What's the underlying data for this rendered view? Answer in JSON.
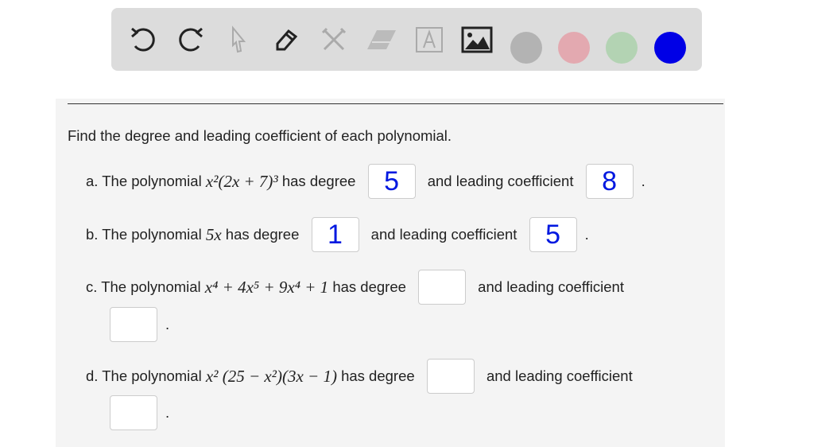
{
  "toolbar": {
    "tools": [
      {
        "name": "undo-icon",
        "active": true
      },
      {
        "name": "redo-icon",
        "active": true
      },
      {
        "name": "pointer-icon",
        "active": false
      },
      {
        "name": "pencil-icon",
        "active": true
      },
      {
        "name": "tools-icon",
        "active": false
      },
      {
        "name": "eraser-icon",
        "active": false
      },
      {
        "name": "text-icon",
        "active": false
      },
      {
        "name": "image-icon",
        "active": true
      }
    ],
    "colors": [
      "#b3b3b3",
      "#e3a9b0",
      "#b3d3b3",
      "#0000e6"
    ]
  },
  "question": {
    "prompt": "Find the degree and leading coefficient of each polynomial.",
    "parts": [
      {
        "label": "a. The polynomial ",
        "expr": "x²(2x + 7)³",
        "mid": " has degree ",
        "deg": "5",
        "end": " and leading coefficient ",
        "coef": "8",
        "period": "."
      },
      {
        "label": "b. The polynomial ",
        "expr": "5x",
        "mid": " has degree ",
        "deg": "1",
        "end": " and leading coefficient ",
        "coef": "5",
        "period": "."
      },
      {
        "label": "c. The polynomial ",
        "expr": "x⁴ + 4x⁵ + 9x⁴ + 1",
        "mid": " has degree ",
        "deg": "",
        "end": " and leading coefficient",
        "coef": "",
        "period": "."
      },
      {
        "label": "d. The polynomial ",
        "expr": "x² (25 − x²)(3x − 1)",
        "mid": " has degree ",
        "deg": "",
        "end": " and leading coefficient",
        "coef": "",
        "period": "."
      }
    ]
  }
}
